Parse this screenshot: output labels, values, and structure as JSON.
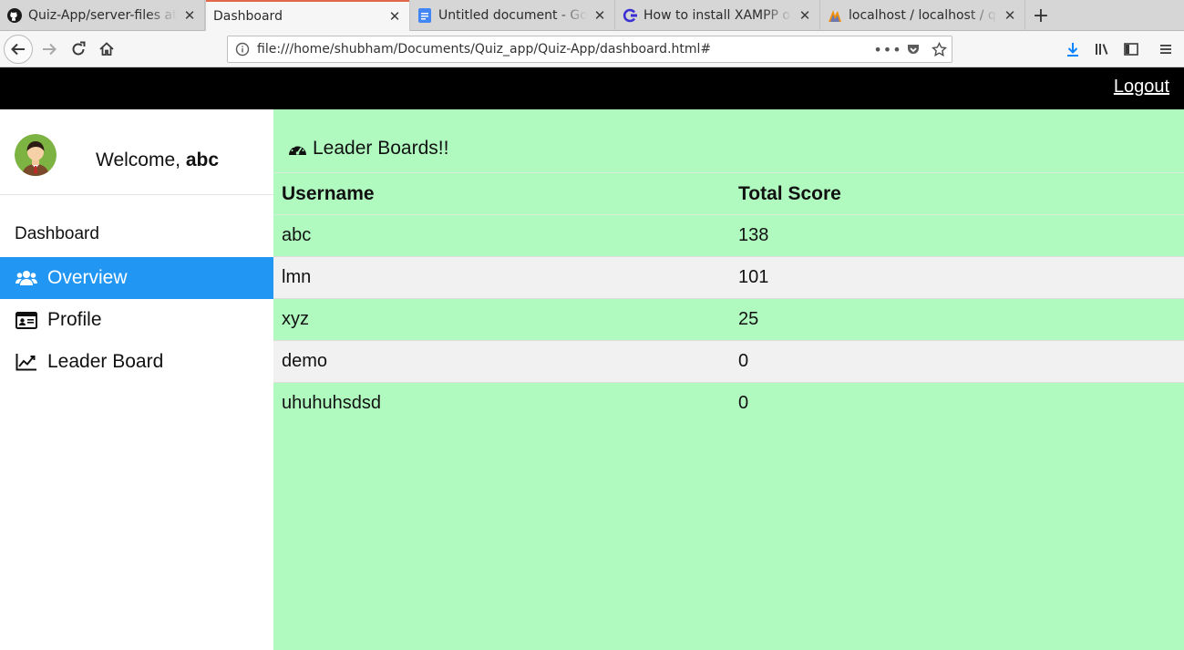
{
  "browser": {
    "tabs": [
      {
        "title": "Quiz-App/server-files at",
        "icon": "github-icon"
      },
      {
        "title": "Dashboard",
        "icon": "",
        "active": true
      },
      {
        "title": "Untitled document - Goo",
        "icon": "google-docs-icon"
      },
      {
        "title": "How to install XAMPP on",
        "icon": "site-icon"
      },
      {
        "title": "localhost / localhost / qu",
        "icon": "phpmyadmin-icon"
      }
    ],
    "url": "file:///home/shubham/Documents/Quiz_app/Quiz-App/dashboard.html#",
    "new_tab_label": "+"
  },
  "topbar": {
    "logout_label": "Logout"
  },
  "sidebar": {
    "welcome_prefix": "Welcome, ",
    "username": "abc",
    "heading": "Dashboard",
    "items": [
      {
        "label": "Overview",
        "icon": "users-icon",
        "active": true
      },
      {
        "label": "Profile",
        "icon": "id-card-icon"
      },
      {
        "label": "Leader Board",
        "icon": "line-chart-icon"
      }
    ]
  },
  "leaderboard": {
    "title": "Leader Boards!!",
    "columns": [
      "Username",
      "Total Score"
    ],
    "rows": [
      {
        "username": "abc",
        "score": "138"
      },
      {
        "username": "lmn",
        "score": "101"
      },
      {
        "username": "xyz",
        "score": "25"
      },
      {
        "username": "demo",
        "score": "0"
      },
      {
        "username": "uhuhuhsdsd",
        "score": "0"
      }
    ]
  },
  "colors": {
    "topbar": "#000000",
    "sidebar_active": "#2196f3",
    "main_bg": "#b0fac0",
    "row_alt": "#f1f1f1",
    "tab_accent": "#e2674a"
  }
}
